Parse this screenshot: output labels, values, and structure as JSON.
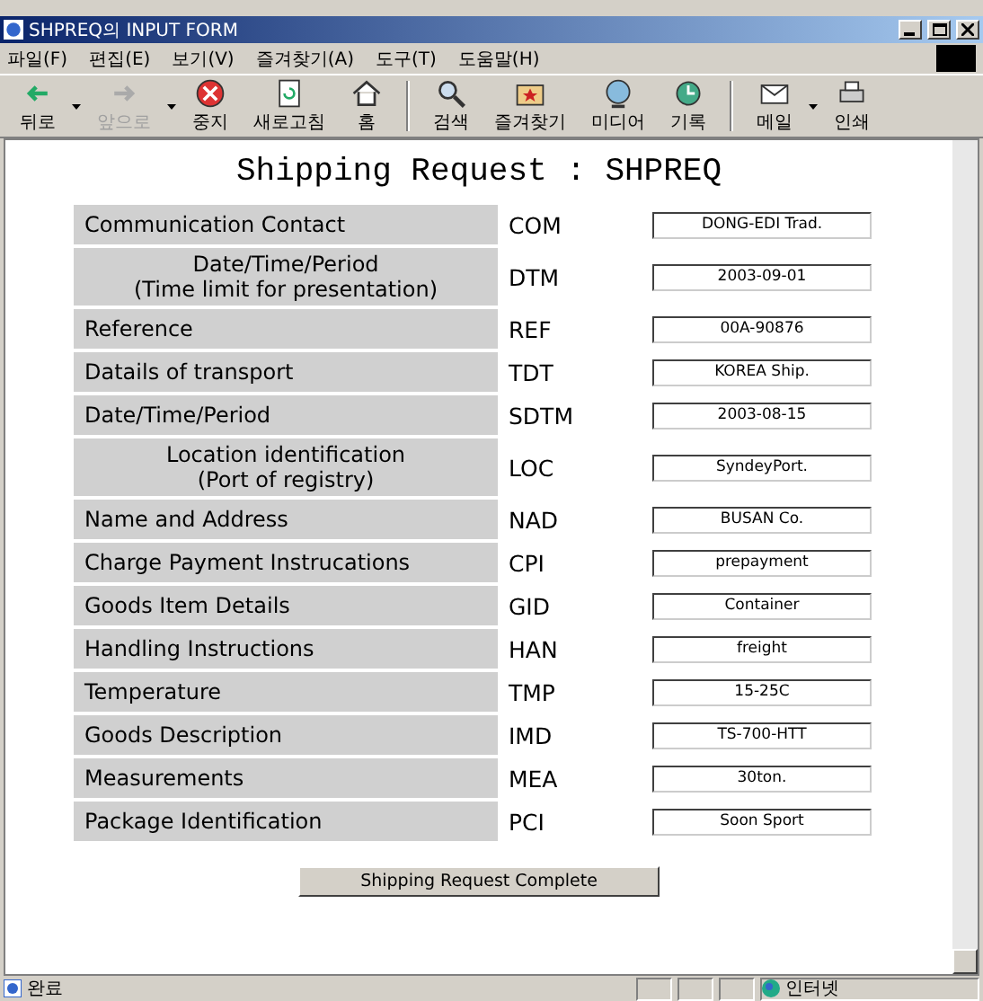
{
  "window": {
    "title": "SHPREQ의 INPUT FORM"
  },
  "menu": [
    "파일(F)",
    "편집(E)",
    "보기(V)",
    "즐겨찾기(A)",
    "도구(T)",
    "도움말(H)"
  ],
  "toolbar": [
    {
      "kind": "back",
      "label": "뒤로",
      "disabled": false,
      "dropdown": true
    },
    {
      "kind": "forward",
      "label": "앞으로",
      "disabled": true,
      "dropdown": true
    },
    {
      "kind": "stop",
      "label": "중지",
      "disabled": false,
      "dropdown": false
    },
    {
      "kind": "refresh",
      "label": "새로고침",
      "disabled": false,
      "dropdown": false
    },
    {
      "kind": "home",
      "label": "홈",
      "disabled": false,
      "dropdown": false
    },
    {
      "kind": "search",
      "label": "검색",
      "disabled": false,
      "dropdown": false
    },
    {
      "kind": "favorites",
      "label": "즐겨찾기",
      "disabled": false,
      "dropdown": false
    },
    {
      "kind": "media",
      "label": "미디어",
      "disabled": false,
      "dropdown": false
    },
    {
      "kind": "history",
      "label": "기록",
      "disabled": false,
      "dropdown": false
    },
    {
      "kind": "mail",
      "label": "메일",
      "disabled": false,
      "dropdown": true
    },
    {
      "kind": "print",
      "label": "인쇄",
      "disabled": false,
      "dropdown": false
    }
  ],
  "page": {
    "heading": "Shipping Request : SHPREQ",
    "rows": [
      {
        "label_lines": [
          "Communication Contact"
        ],
        "code": "COM",
        "value": "DONG-EDI Trad."
      },
      {
        "label_lines": [
          "Date/Time/Period",
          "(Time limit for presentation)"
        ],
        "code": "DTM",
        "value": "2003-09-01"
      },
      {
        "label_lines": [
          "Reference"
        ],
        "code": "REF",
        "value": "00A-90876"
      },
      {
        "label_lines": [
          "Datails of transport"
        ],
        "code": "TDT",
        "value": "KOREA Ship."
      },
      {
        "label_lines": [
          "Date/Time/Period"
        ],
        "code": "SDTM",
        "value": "2003-08-15"
      },
      {
        "label_lines": [
          "Location identification",
          "(Port of registry)"
        ],
        "code": "LOC",
        "value": "SyndeyPort."
      },
      {
        "label_lines": [
          "Name and Address"
        ],
        "code": "NAD",
        "value": "BUSAN Co."
      },
      {
        "label_lines": [
          "Charge Payment Instrucations"
        ],
        "code": "CPI",
        "value": "prepayment"
      },
      {
        "label_lines": [
          "Goods Item Details"
        ],
        "code": "GID",
        "value": "Container"
      },
      {
        "label_lines": [
          "Handling Instructions"
        ],
        "code": "HAN",
        "value": "freight"
      },
      {
        "label_lines": [
          "Temperature"
        ],
        "code": "TMP",
        "value": "15-25C"
      },
      {
        "label_lines": [
          "Goods Description"
        ],
        "code": "IMD",
        "value": "TS-700-HTT"
      },
      {
        "label_lines": [
          "Measurements"
        ],
        "code": "MEA",
        "value": "30ton."
      },
      {
        "label_lines": [
          "Package Identification"
        ],
        "code": "PCI",
        "value": "Soon Sport"
      }
    ],
    "submit": "Shipping Request Complete"
  },
  "status_bar": {
    "status": "완료",
    "zone": "인터넷"
  }
}
